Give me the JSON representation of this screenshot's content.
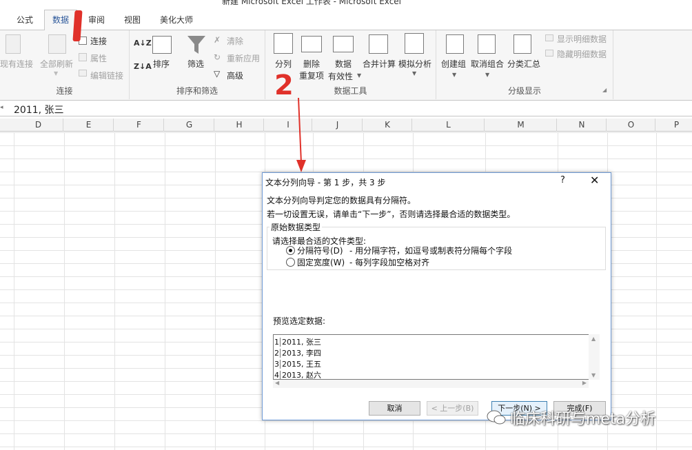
{
  "window": {
    "title": "新建 Microsoft Excel 工作表 - Microsoft Excel"
  },
  "tabs": [
    {
      "label": "公式"
    },
    {
      "label": "数据"
    },
    {
      "label": "审阅"
    },
    {
      "label": "视图"
    },
    {
      "label": "美化大师"
    }
  ],
  "ribbon": {
    "existing_connections": "现有连接",
    "refresh_all": "全部刷新",
    "connections": "连接",
    "properties": "属性",
    "edit_links": "编辑链接",
    "group_connections": "连接",
    "sort": "排序",
    "filter": "筛选",
    "clear": "清除",
    "reapply": "重新应用",
    "advanced": "高级",
    "group_sort_filter": "排序和筛选",
    "text_to_columns": "分列",
    "remove_duplicates_1": "删除",
    "remove_duplicates_2": "重复项",
    "data_validation_1": "数据",
    "data_validation_2": "有效性",
    "consolidate": "合并计算",
    "what_if": "模拟分析",
    "group_data_tools": "数据工具",
    "group": "创建组",
    "ungroup": "取消组合",
    "subtotal": "分类汇总",
    "show_detail": "显示明细数据",
    "hide_detail": "隐藏明细数据",
    "group_outline": "分级显示"
  },
  "formula_bar": {
    "value": "2011, 张三"
  },
  "columns": [
    "D",
    "E",
    "F",
    "G",
    "H",
    "I",
    "J",
    "K",
    "L",
    "M",
    "N",
    "O",
    "P"
  ],
  "annotations": {
    "step2": "2"
  },
  "dialog": {
    "title": "文本分列向导 - 第 1 步，共 3 步",
    "help": "?",
    "close": "✕",
    "line1": "文本分列向导判定您的数据具有分隔符。",
    "line2": "若一切设置无误，请单击“下一步”，否则请选择最合适的数据类型。",
    "section_title": "原始数据类型",
    "prompt": "请选择最合适的文件类型:",
    "option_delimited": "分隔符号(D)",
    "option_delimited_desc": "- 用分隔字符，如逗号或制表符分隔每个字段",
    "option_fixed": "固定宽度(W)",
    "option_fixed_desc": "- 每列字段加空格对齐",
    "preview_label": "预览选定数据:",
    "preview_rows": [
      {
        "n": "1",
        "text": "2011, 张三"
      },
      {
        "n": "2",
        "text": "2013, 李四"
      },
      {
        "n": "3",
        "text": "2015, 王五"
      },
      {
        "n": "4",
        "text": "2013, 赵六"
      }
    ],
    "btn_cancel": "取消",
    "btn_back": "< 上一步(B)",
    "btn_next": "下一步(N) >",
    "btn_finish": "完成(F)"
  },
  "watermark": "临床科研与meta分析"
}
